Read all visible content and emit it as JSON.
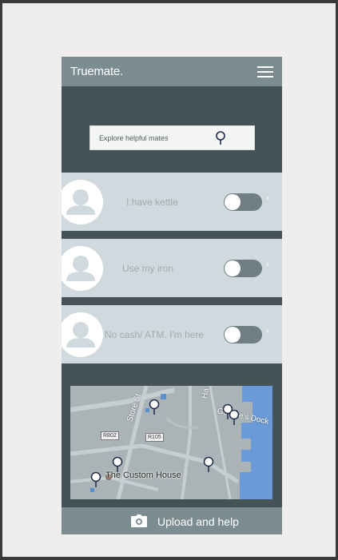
{
  "app": {
    "title": "Truemate.",
    "menu_icon": "hamburger-menu-icon"
  },
  "search": {
    "placeholder": "Explore helpful mates",
    "icon": "map-pin-icon"
  },
  "cards": [
    {
      "label": "I have kettle",
      "toggle_on": false,
      "icon": "user-avatar-icon"
    },
    {
      "label": "Use my iron",
      "toggle_on": false,
      "icon": "user-avatar-icon"
    },
    {
      "label": "No cash/ ATM. I'm here",
      "toggle_on": false,
      "icon": "user-avatar-icon"
    }
  ],
  "map": {
    "street_labels": [
      "Store St",
      "George's Dock",
      "Ha"
    ],
    "road_labels": [
      "R802",
      "R105"
    ],
    "place_label": "The Custom House",
    "pin_count": 6,
    "colors": {
      "land": "#aab4b6",
      "water": "#6a9bd8",
      "roads": "#c7cecf"
    }
  },
  "upload": {
    "label": "Upload and help",
    "icon": "camera-icon"
  },
  "colors": {
    "appbar": "#7c8d92",
    "background": "#455357",
    "card": "#d0dade",
    "toggle_track": "#6f7f83"
  }
}
